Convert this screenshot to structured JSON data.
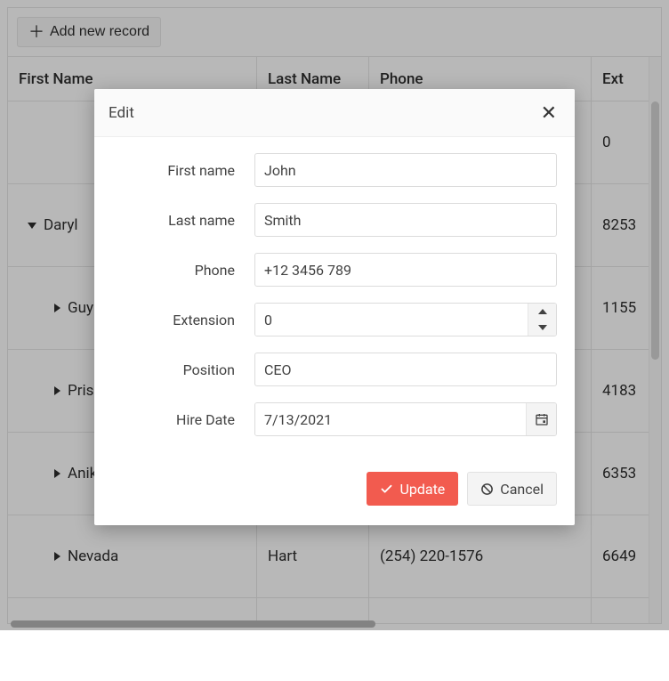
{
  "toolbar": {
    "add_label": "Add new record"
  },
  "columns": {
    "first_name": "First Name",
    "last_name": "Last Name",
    "phone": "Phone",
    "ext": "Ext"
  },
  "rows": [
    {
      "first": "",
      "last": "",
      "phone": "",
      "ext": "0",
      "depth": 0,
      "arrow": "none"
    },
    {
      "first": "Daryl",
      "last": "",
      "phone": "",
      "ext": "8253",
      "depth": 1,
      "arrow": "down"
    },
    {
      "first": "Guy",
      "last": "",
      "phone": "",
      "ext": "1155",
      "depth": 2,
      "arrow": "right"
    },
    {
      "first": "Priscilla",
      "last": "",
      "phone": "",
      "ext": "4183",
      "depth": 2,
      "arrow": "right"
    },
    {
      "first": "Anika",
      "last": "",
      "phone": "",
      "ext": "6353",
      "depth": 2,
      "arrow": "right"
    },
    {
      "first": "Nevada",
      "last": "Hart",
      "phone": "(254) 220-1576",
      "ext": "6649",
      "depth": 2,
      "arrow": "right"
    }
  ],
  "modal": {
    "title": "Edit",
    "fields": {
      "first_name": {
        "label": "First name",
        "value": "John"
      },
      "last_name": {
        "label": "Last name",
        "value": "Smith"
      },
      "phone": {
        "label": "Phone",
        "value": "+12 3456 789"
      },
      "extension": {
        "label": "Extension",
        "value": "0"
      },
      "position": {
        "label": "Position",
        "value": "CEO"
      },
      "hire_date": {
        "label": "Hire Date",
        "value": "7/13/2021"
      }
    },
    "buttons": {
      "update": "Update",
      "cancel": "Cancel"
    }
  }
}
